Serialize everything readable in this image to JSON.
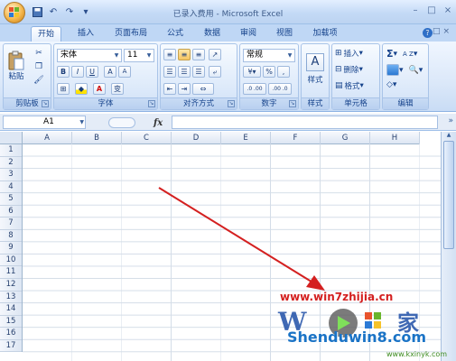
{
  "window": {
    "title": "已录入费用 - Microsoft Excel",
    "controls": [
      "–",
      "□",
      "×"
    ]
  },
  "quick_access": [
    "save-icon",
    "undo-icon",
    "redo-icon",
    "customize-icon"
  ],
  "tabs": [
    {
      "label": "开始",
      "active": true
    },
    {
      "label": "插入"
    },
    {
      "label": "页面布局"
    },
    {
      "label": "公式"
    },
    {
      "label": "数据"
    },
    {
      "label": "审阅"
    },
    {
      "label": "视图"
    },
    {
      "label": "加载项"
    }
  ],
  "ribbon": {
    "clipboard": {
      "label": "剪贴板",
      "paste": "粘贴"
    },
    "font": {
      "label": "字体",
      "name": "宋体",
      "size": "11",
      "bold": "B",
      "italic": "I",
      "underline": "U",
      "grow": "A",
      "shrink": "A",
      "font_color": "A",
      "phonetic": "变"
    },
    "alignment": {
      "label": "对齐方式"
    },
    "number": {
      "label": "数字",
      "format": "常规",
      "percent": "%",
      "comma": ",",
      "inc_decimal": ".0 .00",
      "dec_decimal": ".00 .0"
    },
    "styles": {
      "label": "样式"
    },
    "cells": {
      "label": "单元格",
      "insert": "插入",
      "delete": "删除",
      "format": "格式"
    },
    "editing": {
      "label": "编辑",
      "sum": "Σ",
      "sort": "A Z"
    }
  },
  "formula_bar": {
    "name_box": "A1",
    "fx": "fx",
    "formula": ""
  },
  "sheet": {
    "columns": [
      "A",
      "B",
      "C",
      "D",
      "E",
      "F",
      "G",
      "H"
    ],
    "rows": [
      "1",
      "2",
      "3",
      "4",
      "5",
      "6",
      "7",
      "8",
      "9",
      "10",
      "11",
      "12",
      "13",
      "14",
      "15",
      "16",
      "17"
    ]
  },
  "watermark": {
    "url": "www.win7zhijia.cn",
    "site": "Shenduwin8.com",
    "url2": "www.kxinyk.com"
  },
  "colors": {
    "ribbon_blue": "#c4daf6",
    "tab_text": "#15428b",
    "arrow_red": "#d42020"
  }
}
